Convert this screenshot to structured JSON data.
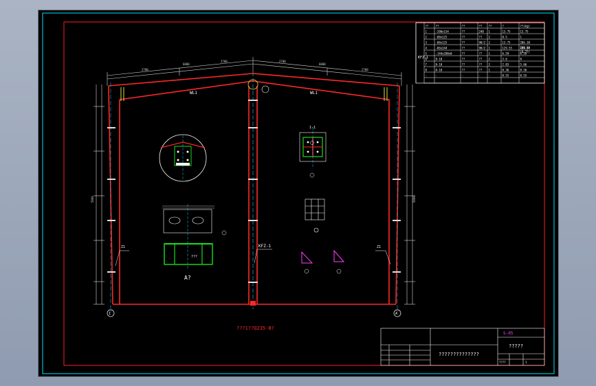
{
  "colors": {
    "background": "#000000",
    "frame": "#ff2020",
    "border": "#00e5ff",
    "column": "#ff2828",
    "text": "#ffffff",
    "axis": "#20c8ff",
    "plate": "#18e018",
    "accent": "#ff40ff",
    "dim": "#d8d8d8"
  },
  "drawing": {
    "caption": "???1??Q235-B?",
    "rafter_left_label": "WL1",
    "rafter_right_label": "WL1",
    "column_label": "KFZ-1",
    "left_col_tag": "Z1",
    "right_col_tag": "Z1",
    "node_a_label": "A?",
    "node_a_sub": "???",
    "section_1_label": "1-1",
    "axis_left": "1",
    "axis_right": "A",
    "eave_dim_left": "2700",
    "eave_dim_right": "2700",
    "height_dim": "5800",
    "detail_labels": [
      "1",
      "2",
      "3",
      "4",
      "5"
    ]
  },
  "material_table": {
    "header": [
      "??",
      "??",
      "??",
      "??",
      "??",
      "?",
      "??(kg)"
    ],
    "member": "KFZ-1",
    "rows": [
      [
        "1",
        "-200x154",
        "??",
        "240",
        "1",
        "13.75",
        "13.75"
      ],
      [
        "2",
        "-88x125",
        "??",
        "??",
        "2",
        "0.5",
        "1"
      ],
      [
        "3",
        "-88x125",
        "??",
        "98/2",
        "2",
        "13.75",
        "206.38"
      ],
      [
        "4",
        "-86x244",
        "??",
        "98/2",
        "1",
        "129.55",
        "129.54"
      ],
      [
        "5",
        "-144x200x8",
        "??",
        "??",
        "1",
        "6.59",
        "6.59"
      ],
      [
        "6",
        "8-10",
        "??",
        "??",
        "2",
        "3.6",
        "8"
      ],
      [
        "7",
        "8-10",
        "??",
        "??",
        "2",
        "2.83",
        "5.66"
      ],
      [
        "8",
        "8-10",
        "??",
        "??",
        "1",
        "0.36",
        "0.36"
      ],
      [
        "-",
        "-",
        "-",
        "-",
        "-",
        "0.55",
        "0.55"
      ]
    ],
    "total": "288.69",
    "total_2": "(0.77)"
  },
  "title_block": {
    "drawing_no": "S-05",
    "title": "?????",
    "project": "??????????????",
    "scale_label": "????",
    "sheet": "1"
  }
}
